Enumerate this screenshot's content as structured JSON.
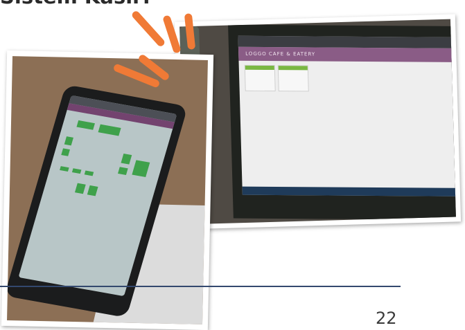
{
  "heading": {
    "text": "Sistem Kasir:"
  },
  "photos": {
    "right": {
      "screen_banner": "LOGGO CAFE & EATERY"
    }
  },
  "footer": {
    "page_number": "22"
  },
  "colors": {
    "accent_orange": "#f07a36",
    "rule_blue": "#33486e",
    "pos_green": "#3fa14b",
    "pos_purple": "#8a5c86"
  }
}
